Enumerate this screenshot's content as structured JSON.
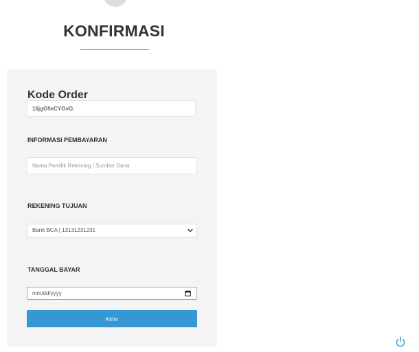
{
  "header": {
    "title": "KONFIRMASI"
  },
  "form": {
    "order_heading": "Kode Order",
    "order_code": "16jgG9eCYGvO.",
    "payment_info_label": "INFORMASI PEMBAYARAN",
    "account_owner_placeholder": "Nama Pemilik Rekening / Sumber Dana",
    "account_owner_value": "",
    "target_account_label": "REKENING TUJUAN",
    "target_account_selected": "Bank BCA | 13131231231",
    "payment_date_label": "TANGGAL BAYAR",
    "payment_date_value": "mm/dd/yyyy",
    "submit_label": "Kirim"
  },
  "icons": {
    "select_chevron": "chevron-down-icon",
    "date_picker": "calendar-icon",
    "floating_action": "power-icon"
  },
  "colors": {
    "accent": "#3598d4",
    "card_background": "#f4f4f5",
    "title_text": "#333333"
  }
}
